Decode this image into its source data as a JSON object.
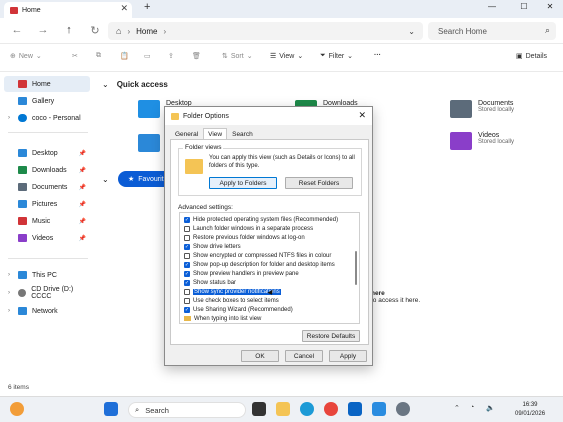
{
  "window": {
    "tab_title": "Home",
    "new_tab": "+",
    "tab_close": "✕",
    "minimize": "—",
    "maximize": "☐",
    "close": "✕"
  },
  "address": {
    "location": "Home",
    "sep": "›",
    "search_placeholder": "Search Home"
  },
  "commands": {
    "new": "New",
    "sort": "Sort",
    "view": "View",
    "filter": "Filter",
    "more": "···",
    "details": "Details"
  },
  "sidebar": {
    "items": [
      {
        "label": "Home",
        "icon": "home-icon",
        "color": "#d13438"
      },
      {
        "label": "Gallery",
        "icon": "gallery-icon",
        "color": "#2b88d8"
      },
      {
        "label": "coco - Personal",
        "icon": "cloud-icon",
        "color": "#0078d4"
      },
      {
        "label": "Desktop",
        "icon": "desktop-icon",
        "color": "#2b88d8"
      },
      {
        "label": "Downloads",
        "icon": "download-icon",
        "color": "#1e8a4a"
      },
      {
        "label": "Documents",
        "icon": "documents-icon",
        "color": "#5c6b7a"
      },
      {
        "label": "Pictures",
        "icon": "pictures-icon",
        "color": "#2b88d8"
      },
      {
        "label": "Music",
        "icon": "music-icon",
        "color": "#d13438"
      },
      {
        "label": "Videos",
        "icon": "videos-icon",
        "color": "#8a3ec9"
      },
      {
        "label": "This PC",
        "icon": "pc-icon",
        "color": "#2b88d8"
      },
      {
        "label": "CD Drive (D:) CCCC",
        "icon": "cd-drive-icon",
        "color": "#777"
      },
      {
        "label": "Network",
        "icon": "network-icon",
        "color": "#2b88d8"
      }
    ]
  },
  "main": {
    "quick_access_title": "Quick access",
    "favourites_label": "Favourit",
    "hint_text": "here",
    "hint_text2": "to access it here.",
    "quick_access": [
      {
        "name": "Desktop",
        "sub": "",
        "color": "#1f8fe3"
      },
      {
        "name": "Downloads",
        "sub": "",
        "color": "#1e8a4a"
      },
      {
        "name": "Documents",
        "sub": "Stored locally",
        "color": "#5c6b7a"
      },
      {
        "name": "",
        "sub": "",
        "color": "#2b88d8"
      },
      {
        "name": "Videos",
        "sub": "Stored locally",
        "color": "#8a3ec9"
      }
    ]
  },
  "status": {
    "items": "6 items"
  },
  "taskbar": {
    "search": "Search",
    "time": "16:39",
    "date": "09/01/2026",
    "start_color": "#1f6fd8"
  },
  "dialog": {
    "title": "Folder Options",
    "tabs": [
      "General",
      "View",
      "Search"
    ],
    "folder_views_label": "Folder views",
    "folder_views_text": "You can apply this view (such as Details or Icons) to all folders of this type.",
    "apply_to_folders": "Apply to Folders",
    "reset_folders": "Reset Folders",
    "advanced_label": "Advanced settings:",
    "settings": [
      {
        "label": "Hide protected operating system files (Recommended)",
        "checked": true
      },
      {
        "label": "Launch folder windows in a separate process",
        "checked": false
      },
      {
        "label": "Restore previous folder windows at log-on",
        "checked": false
      },
      {
        "label": "Show drive letters",
        "checked": true
      },
      {
        "label": "Show encrypted or compressed NTFS files in colour",
        "checked": false
      },
      {
        "label": "Show pop-up description for folder and desktop items",
        "checked": true
      },
      {
        "label": "Show preview handlers in preview pane",
        "checked": true
      },
      {
        "label": "Show status bar",
        "checked": true
      },
      {
        "label": "Show sync provider notifications",
        "checked": false,
        "selected": true
      },
      {
        "label": "Use check boxes to select items",
        "checked": false
      },
      {
        "label": "Use Sharing Wizard (Recommended)",
        "checked": true
      },
      {
        "label": "When typing into list view",
        "folder": true
      }
    ],
    "restore_defaults": "Restore Defaults",
    "ok": "OK",
    "cancel": "Cancel",
    "apply": "Apply"
  }
}
